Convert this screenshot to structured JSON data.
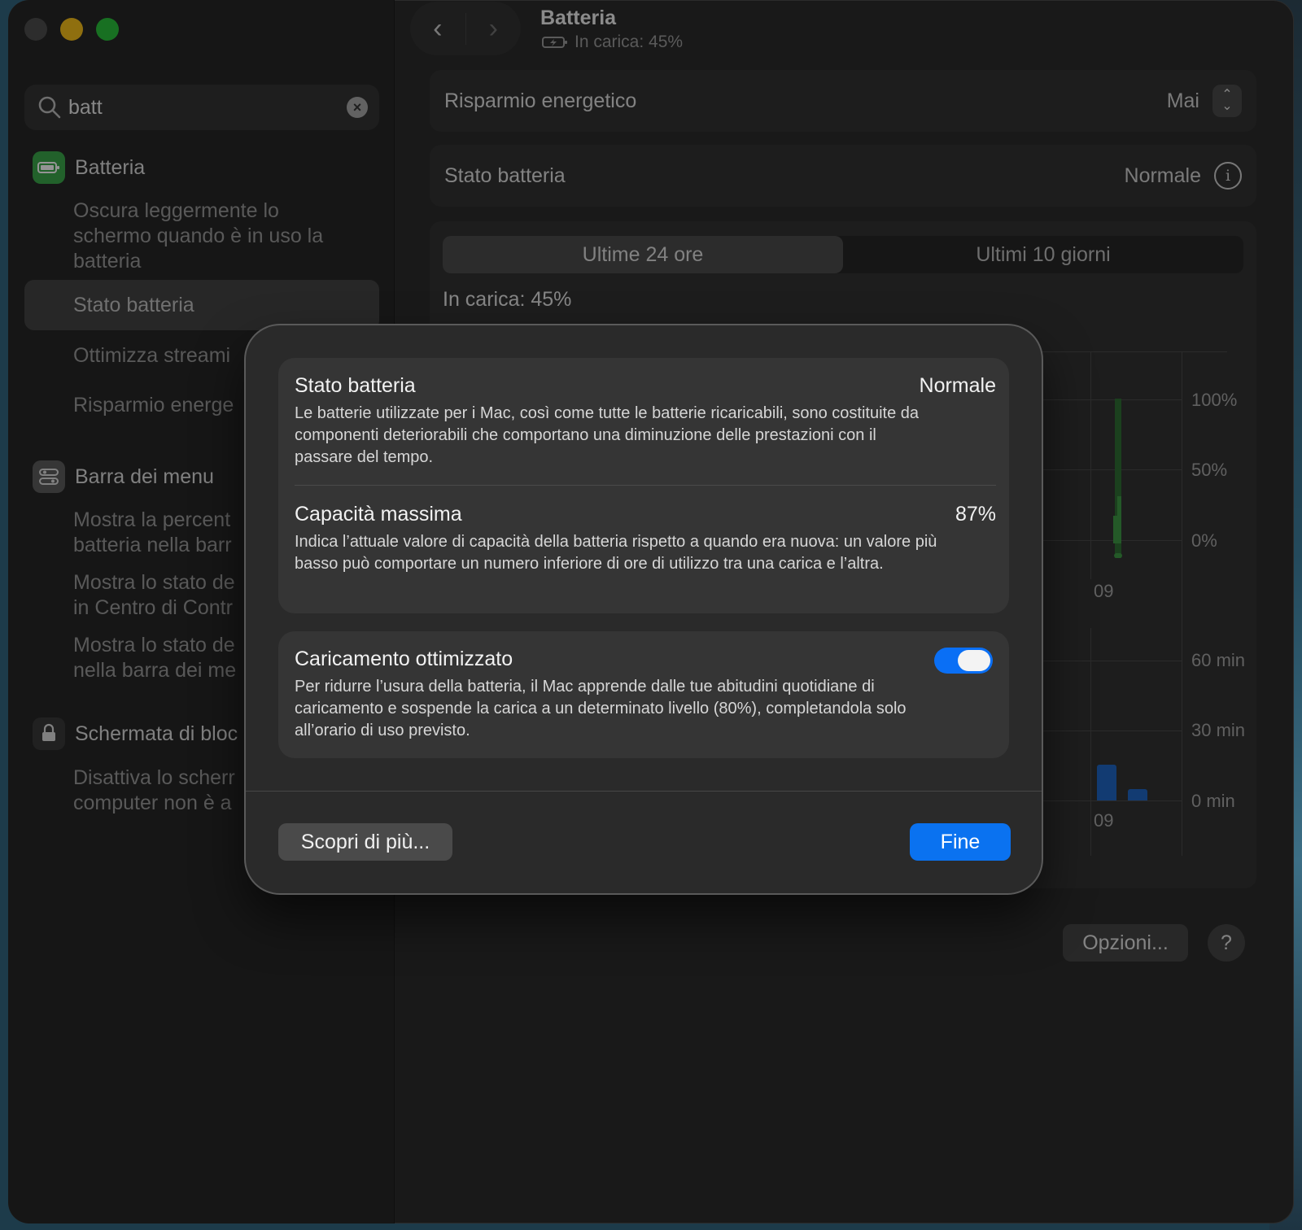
{
  "window": {
    "title": "Batteria",
    "subtitle": "In carica: 45%"
  },
  "sidebar": {
    "search_value": "batt",
    "sections": [
      {
        "label": "Batteria",
        "items": [
          "Oscura leggermente lo schermo quando è in uso la batteria",
          "Stato batteria",
          "Ottimizza streami",
          "Risparmio energe"
        ]
      },
      {
        "label": "Barra dei menu",
        "items": [
          "Mostra la percent batteria nella barr",
          "Mostra lo stato de in Centro di Contr",
          "Mostra lo stato de nella barra dei me"
        ]
      },
      {
        "label": "Schermata di bloc",
        "items": [
          "Disattiva lo scherr computer non è a"
        ]
      }
    ]
  },
  "main": {
    "low_power": {
      "label": "Risparmio energetico",
      "value": "Mai"
    },
    "health": {
      "label": "Stato batteria",
      "value": "Normale"
    },
    "tabs": [
      "Ultime 24 ore",
      "Ultimi 10 giorni"
    ],
    "charge_label": "In carica: 45%",
    "options_button": "Opzioni...",
    "help_button": "?"
  },
  "chart_data": [
    {
      "type": "bar",
      "y_ticks": [
        "100%",
        "50%",
        "0%"
      ],
      "x_ticks": [
        "09"
      ],
      "ylim": [
        0,
        100
      ],
      "color": "#3f9a45"
    },
    {
      "type": "bar",
      "y_ticks": [
        "60 min",
        "30 min",
        "0 min"
      ],
      "x_ticks": [
        "09"
      ],
      "ylim": [
        0,
        60
      ],
      "color": "#1f67c4"
    }
  ],
  "modal": {
    "health_title": "Stato batteria",
    "health_value": "Normale",
    "health_desc": "Le batterie utilizzate per i Mac, così come tutte le batterie ricaricabili, sono costituite da componenti deteriorabili che comportano una diminuzione delle prestazioni con il passare del tempo.",
    "capacity_title": "Capacità massima",
    "capacity_value": "87%",
    "capacity_desc": "Indica l’attuale valore di capacità della batteria rispetto a quando era nuova: un valore più basso può comportare un numero inferiore di ore di utilizzo tra una carica e l’altra.",
    "optimized_title": "Caricamento ottimizzato",
    "optimized_on": true,
    "optimized_desc": "Per ridurre l’usura della batteria, il Mac apprende dalle tue abitudini quotidiane di caricamento e sospende la carica a un determinato livello (80%), completandola solo all’orario di uso previsto.",
    "learn_more": "Scopri di più...",
    "done": "Fine"
  }
}
